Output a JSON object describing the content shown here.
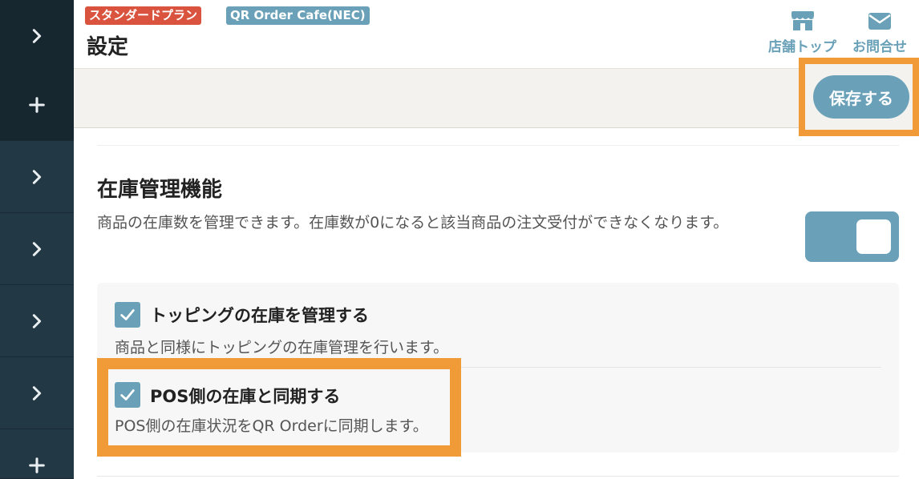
{
  "sidebar": {
    "items": [
      {
        "icon": "chevron-right-icon"
      },
      {
        "icon": "plus-icon"
      },
      {
        "icon": "chevron-right-icon"
      },
      {
        "icon": "chevron-right-icon"
      },
      {
        "icon": "chevron-right-icon"
      },
      {
        "icon": "chevron-right-icon"
      },
      {
        "icon": "plus-icon"
      }
    ]
  },
  "header": {
    "plan_badge": "スタンダードプラン",
    "store_badge": "QR Order Cafe(NEC)",
    "title": "設定",
    "store_top_label": "店舗トップ",
    "contact_label": "お問合せ"
  },
  "toolbar": {
    "save_label": "保存する"
  },
  "inventory": {
    "title": "在庫管理機能",
    "description": "商品の在庫数を管理できます。在庫数が0になると該当商品の注文受付ができなくなります。",
    "enabled": true,
    "options": [
      {
        "label": "トッピングの在庫を管理する",
        "description": "商品と同様にトッピングの在庫管理を行います。",
        "checked": true
      },
      {
        "label": "POS側の在庫と同期する",
        "description": "POS側の在庫状況をQR Orderに同期します。",
        "checked": true
      }
    ]
  },
  "colors": {
    "accent": "#6aa1b8",
    "highlight": "#f19a38",
    "plan_badge": "#d9533e",
    "sidebar": "#233845"
  }
}
